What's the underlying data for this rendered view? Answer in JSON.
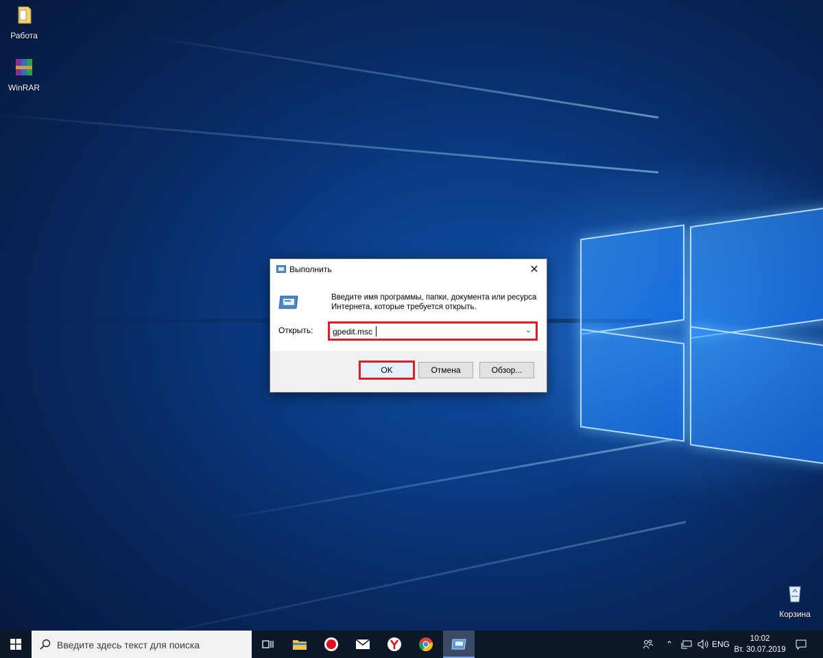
{
  "desktop": {
    "icons": [
      {
        "label": "Работа",
        "icon": "folder-icon"
      },
      {
        "label": "WinRAR",
        "icon": "winrar-icon"
      },
      {
        "label": "Корзина",
        "icon": "recycle-bin-icon"
      }
    ]
  },
  "run_dialog": {
    "title": "Выполнить",
    "description": "Введите имя программы, папки, документа или ресурса Интернета, которые требуется открыть.",
    "open_label": "Открыть:",
    "open_value": "gpedit.msc",
    "buttons": {
      "ok": "OK",
      "cancel": "Отмена",
      "browse": "Обзор..."
    },
    "highlight_color": "#e01b24"
  },
  "taskbar": {
    "search_placeholder": "Введите здесь текст для поиска",
    "apps": [
      "task-view-icon",
      "file-explorer-icon",
      "recorder-icon",
      "mail-icon",
      "yandex-browser-icon",
      "chrome-icon",
      "run-app-icon"
    ],
    "language": "ENG",
    "time": "10:02",
    "date": "Вт. 30.07.2019"
  }
}
